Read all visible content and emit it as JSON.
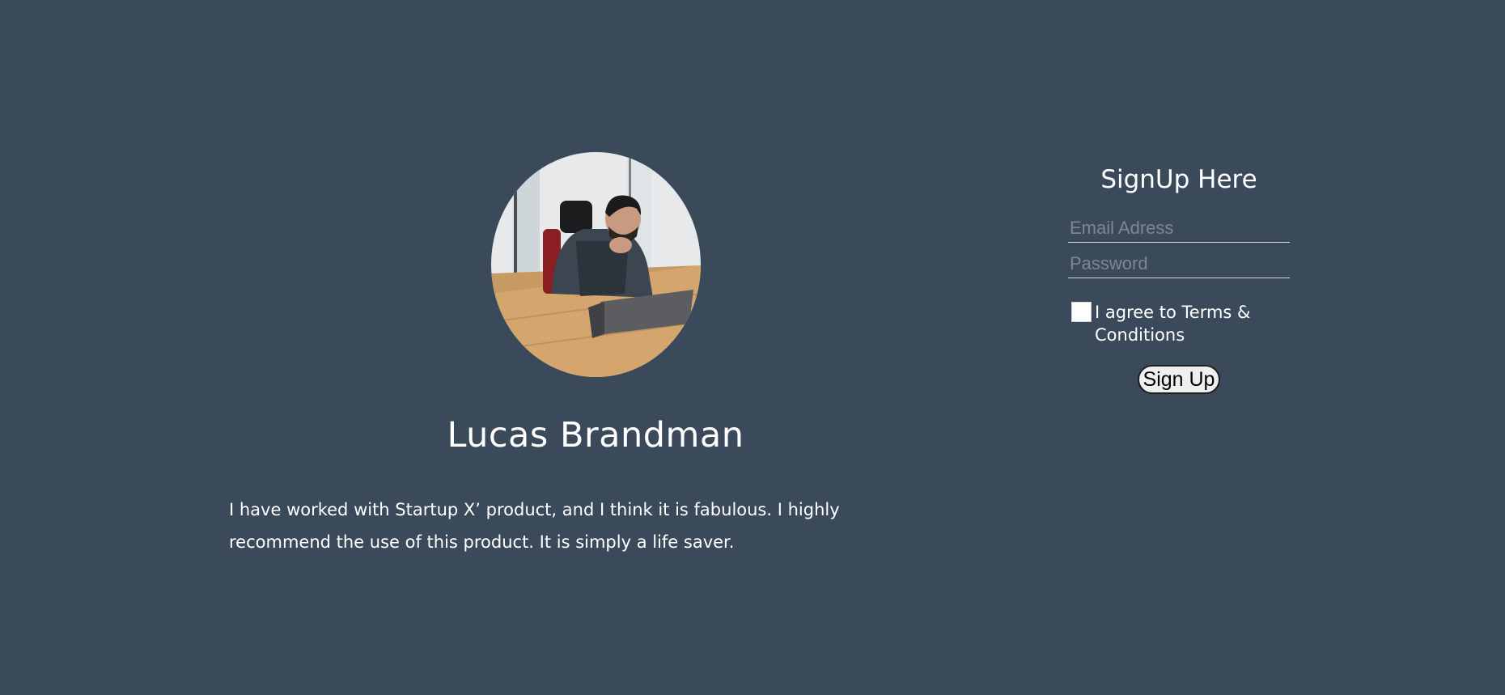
{
  "testimonial": {
    "name": "Lucas Brandman",
    "quote": "I have worked with Startup X’ product, and I think it is fabulous. I highly recommend the use of this product. It is simply a life saver."
  },
  "signup": {
    "title": "SignUp Here",
    "email_placeholder": "Email Adress",
    "password_placeholder": "Password",
    "terms_label": "I agree to Terms & Conditions",
    "button_label": "Sign Up"
  },
  "colors": {
    "background": "#3a4a5a",
    "text": "#ffffff"
  },
  "icons": {
    "avatar": "person-photo"
  }
}
